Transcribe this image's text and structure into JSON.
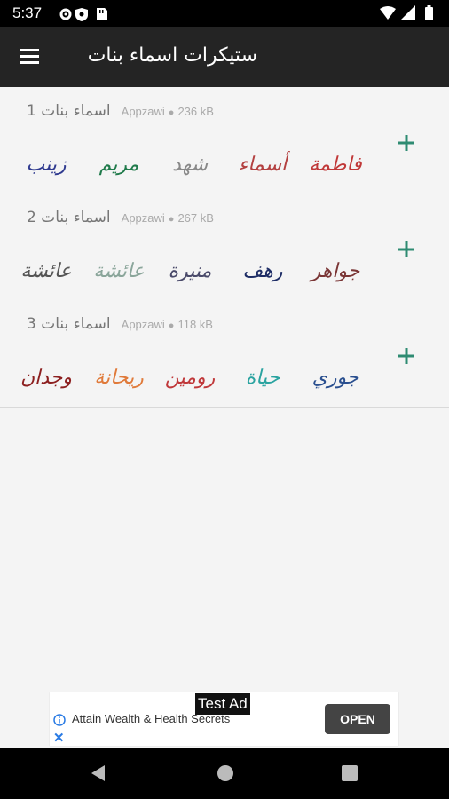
{
  "status_bar": {
    "time": "5:37"
  },
  "app_bar": {
    "title": "ستيكرات اسماء بنات"
  },
  "packs": [
    {
      "name": "اسماء بنات 1",
      "author": "Appzawi",
      "size": "236 kB",
      "stickers": [
        {
          "name": "زينب",
          "color": "#2f3a8f"
        },
        {
          "name": "مريم",
          "color": "#1f7a4a"
        },
        {
          "name": "شهد",
          "color": "#888888"
        },
        {
          "name": "أسماء",
          "color": "#b34040"
        },
        {
          "name": "فاطمة",
          "color": "#c03838"
        }
      ]
    },
    {
      "name": "اسماء بنات 2",
      "author": "Appzawi",
      "size": "267 kB",
      "stickers": [
        {
          "name": "عائشة",
          "color": "#555555"
        },
        {
          "name": "عائشة",
          "color": "#8aa59a"
        },
        {
          "name": "منيرة",
          "color": "#4a4a6a"
        },
        {
          "name": "رهف",
          "color": "#1e2d66"
        },
        {
          "name": "جواهر",
          "color": "#7a3535"
        }
      ]
    },
    {
      "name": "اسماء بنات 3",
      "author": "Appzawi",
      "size": "118 kB",
      "stickers": [
        {
          "name": "وجدان",
          "color": "#8c1f1f"
        },
        {
          "name": "ريحانة",
          "color": "#e07a3a"
        },
        {
          "name": "رومين",
          "color": "#c0383a"
        },
        {
          "name": "حياة",
          "color": "#2aa3a0"
        },
        {
          "name": "جوري",
          "color": "#2a4f8f"
        }
      ]
    }
  ],
  "ad": {
    "label": "Test Ad",
    "headline": "Attain Wealth & Health Secrets",
    "button": "OPEN",
    "close": "✕"
  },
  "colors": {
    "accent": "#2e8b72",
    "app_bar": "#242424"
  }
}
